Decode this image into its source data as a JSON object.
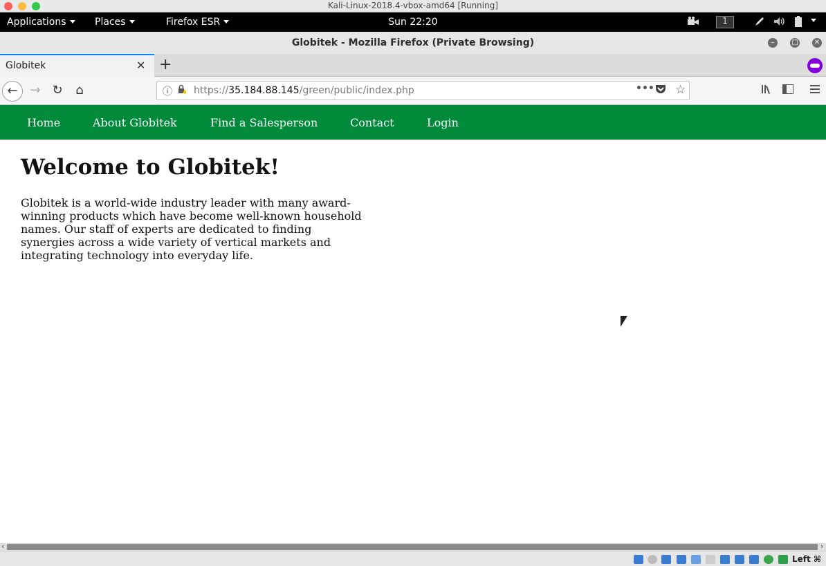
{
  "host_window": {
    "title": "Kali-Linux-2018.4-vbox-amd64 [Running]",
    "traffic_colors": [
      "#fc605b",
      "#fdbc40",
      "#34c84a"
    ]
  },
  "gnome_panel": {
    "applications": "Applications",
    "places": "Places",
    "app_menu": "Firefox ESR",
    "clock": "Sun 22:20",
    "workspace": "1"
  },
  "firefox": {
    "window_title": "Globitek - Mozilla Firefox (Private Browsing)",
    "tab_label": "Globitek",
    "url_scheme_host": "https://",
    "url_host": "35.184.88.145",
    "url_path": "/green/public/index.php"
  },
  "site": {
    "nav": [
      "Home",
      "About Globitek",
      "Find a Salesperson",
      "Contact",
      "Login"
    ],
    "heading": "Welcome to Globitek!",
    "paragraph": "Globitek is a world-wide industry leader with many award-winning products which have become well-known household names. Our staff of experts are dedicated to finding synergies across a wide variety of vertical markets and integrating technology into everyday life.",
    "nav_color": "#008a3a"
  },
  "vbox_status": {
    "host_key": "Left ⌘"
  }
}
